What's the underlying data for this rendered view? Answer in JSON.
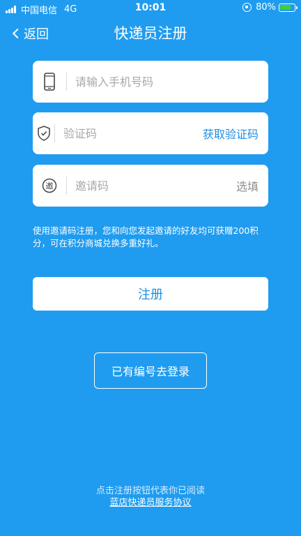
{
  "status_bar": {
    "carrier": "中国电信",
    "network": "4G",
    "time": "10:01",
    "battery": "80%",
    "battery_color": "#3ed03e"
  },
  "nav": {
    "back_label": "返回",
    "title": "快递员注册"
  },
  "form": {
    "phone": {
      "placeholder": "请输入手机号码",
      "value": "",
      "icon": "phone-icon"
    },
    "code": {
      "placeholder": "验证码",
      "value": "",
      "icon": "shield-check-icon",
      "action_label": "获取验证码"
    },
    "invite": {
      "placeholder": "邀请码",
      "value": "",
      "icon": "invite-badge-icon",
      "icon_text": "邀",
      "optional_label": "选填"
    }
  },
  "hint": "使用邀请码注册，您和向您发起邀请的好友均可获赠200积分，可在积分商城兑换多重好礼。",
  "register_button": "注册",
  "login_button": "已有编号去登录",
  "footer": {
    "note": "点击注册按钮代表你已阅读",
    "agreement_link": "蓝店快递员服务协议"
  },
  "colors": {
    "background": "#1f9cf0",
    "accent": "#1f8fe0"
  }
}
